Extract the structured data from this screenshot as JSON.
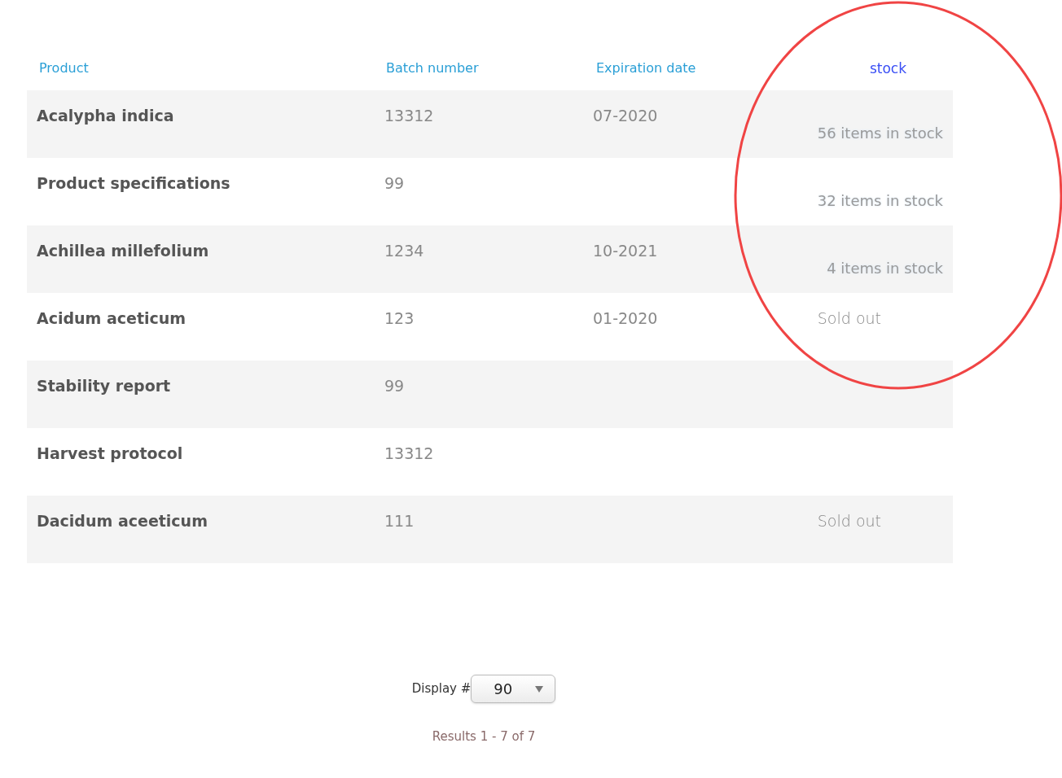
{
  "table": {
    "columns": [
      "Product",
      "Batch number",
      "Expiration date",
      "stock"
    ],
    "rows": [
      {
        "product": "Acalypha indica",
        "batch": "13312",
        "expiration": "07-2020",
        "stock": {
          "kind": "in_stock",
          "text": "56 items in stock"
        }
      },
      {
        "product": "Product specifications",
        "batch": "99",
        "expiration": "",
        "stock": {
          "kind": "in_stock",
          "text": "32 items in stock"
        }
      },
      {
        "product": "Achillea millefolium",
        "batch": "1234",
        "expiration": "10-2021",
        "stock": {
          "kind": "in_stock",
          "text": "4 items in stock"
        }
      },
      {
        "product": "Acidum aceticum",
        "batch": "123",
        "expiration": "01-2020",
        "stock": {
          "kind": "sold_out",
          "text": "Sold out"
        }
      },
      {
        "product": "Stability report",
        "batch": "99",
        "expiration": "",
        "stock": null
      },
      {
        "product": "Harvest protocol",
        "batch": "13312",
        "expiration": "",
        "stock": null
      },
      {
        "product": "Dacidum aceeticum",
        "batch": "111",
        "expiration": "",
        "stock": {
          "kind": "sold_out",
          "text": "Sold out"
        }
      }
    ]
  },
  "pagination": {
    "display_label": "Display #",
    "display_value": "90",
    "results": "Results 1 - 7 of 7"
  }
}
